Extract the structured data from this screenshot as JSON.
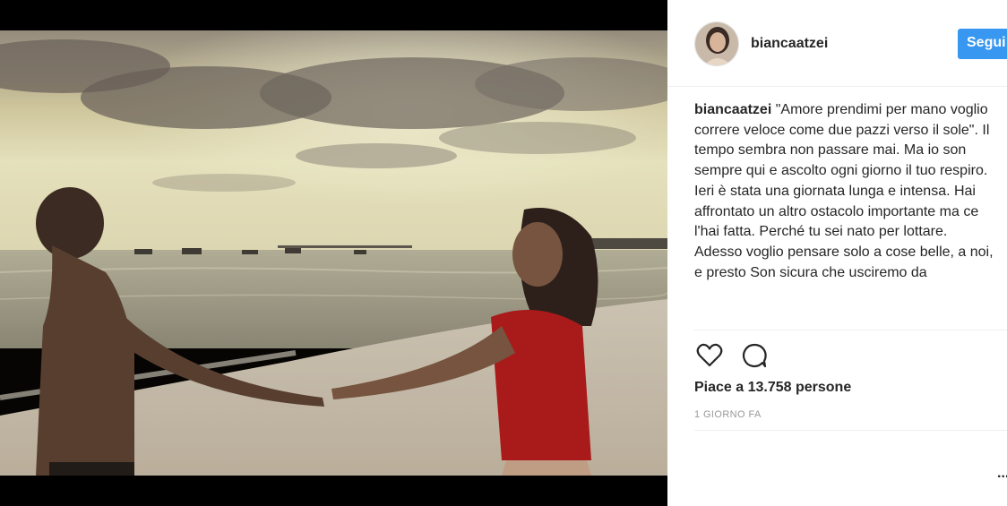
{
  "post": {
    "username": "biancaatzei",
    "follow_label": "Segui",
    "caption": {
      "username": "biancaatzei",
      "text": "\"Amore prendimi per mano voglio correre veloce come due pazzi verso il sole\". Il tempo sembra non passare mai. Ma io son sempre qui e ascolto ogni giorno il tuo respiro.",
      "line2": "Ieri è stata una giornata lunga e intensa. Hai affrontato un altro ostacolo importante ma ce l'hai fatta. Perché tu sei nato per lottare.",
      "line3": "Adesso voglio pensare solo a cose belle, a noi, e presto Son sicura che usciremo da"
    },
    "likes": "Piace a 13.758 persone",
    "timestamp": "1 GIORNO FA",
    "more_glyph": "..."
  },
  "icons": {
    "like": "heart-icon",
    "comment": "comment-bubble-icon"
  },
  "colors": {
    "follow_button": "#3897f0",
    "text": "#262626",
    "muted": "#999999",
    "dress": "#b0181a"
  }
}
